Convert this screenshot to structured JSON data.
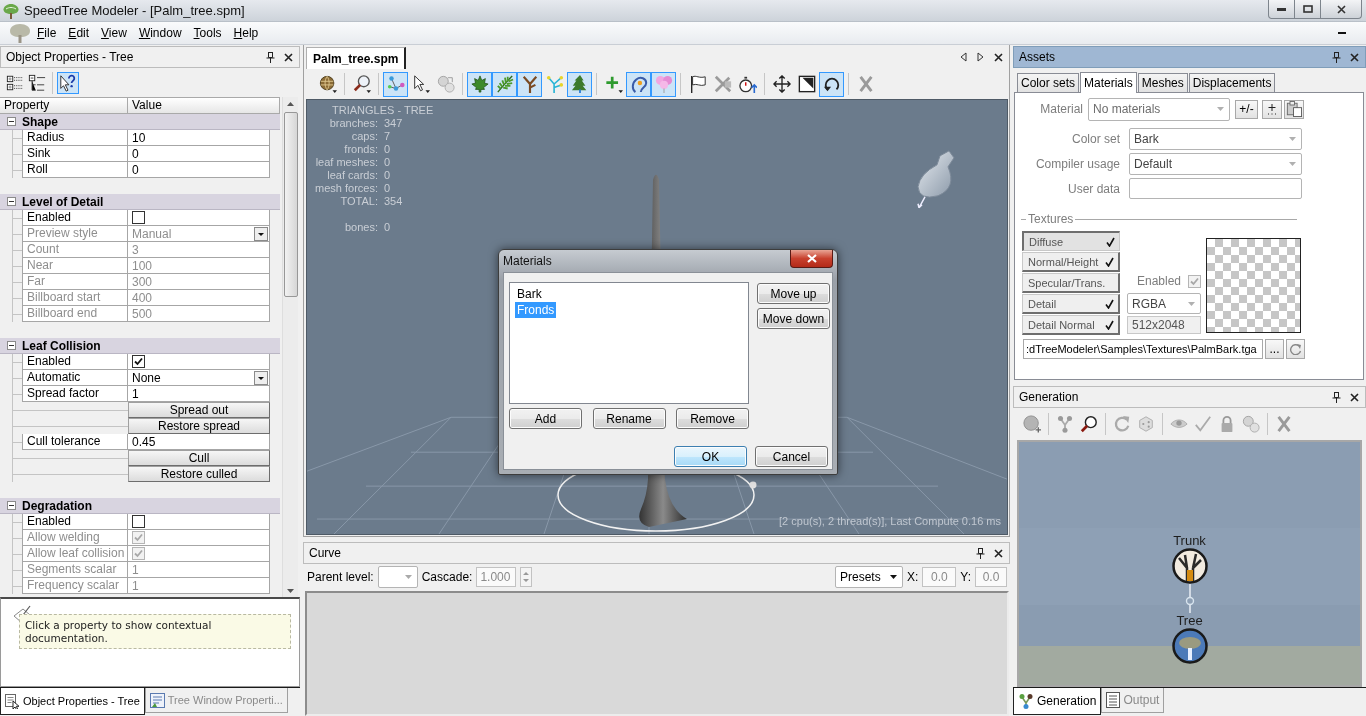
{
  "window": {
    "title": "SpeedTree Modeler - [Palm_tree.spm]"
  },
  "menu": [
    "File",
    "Edit",
    "View",
    "Window",
    "Tools",
    "Help"
  ],
  "object_properties": {
    "title": "Object Properties - Tree",
    "active": false,
    "toolbar": [
      {
        "selected": false
      },
      {
        "selected": false
      },
      {
        "selected": true
      }
    ],
    "columns": [
      "Property",
      "Value"
    ],
    "categories": [
      {
        "name": "Shape",
        "expanded": true,
        "rows": [
          {
            "kind": "text",
            "label": "Radius",
            "value": "10",
            "disabled": false
          },
          {
            "kind": "text",
            "label": "Sink",
            "value": "0",
            "disabled": false
          },
          {
            "kind": "text",
            "label": "Roll",
            "value": "0",
            "disabled": false
          }
        ]
      },
      {
        "name": "Level of Detail",
        "expanded": true,
        "rows": [
          {
            "kind": "checkbox",
            "label": "Enabled",
            "checked": false,
            "disabled": false
          },
          {
            "kind": "dropdown",
            "label": "Preview style",
            "value": "Manual",
            "disabled": true
          },
          {
            "kind": "text",
            "label": "Count",
            "value": "3",
            "disabled": true
          },
          {
            "kind": "text",
            "label": "Near",
            "value": "100",
            "disabled": true
          },
          {
            "kind": "text",
            "label": "Far",
            "value": "300",
            "disabled": true
          },
          {
            "kind": "text",
            "label": "Billboard start",
            "value": "400",
            "disabled": true
          },
          {
            "kind": "text",
            "label": "Billboard end",
            "value": "500",
            "disabled": true
          }
        ]
      },
      {
        "name": "Leaf Collision",
        "expanded": true,
        "rows": [
          {
            "kind": "checkbox",
            "label": "Enabled",
            "checked": true,
            "disabled": false
          },
          {
            "kind": "dropdown",
            "label": "Automatic",
            "value": "None",
            "disabled": false
          },
          {
            "kind": "text",
            "label": "Spread factor",
            "value": "1",
            "disabled": false
          },
          {
            "kind": "button",
            "label": "Spread out",
            "disabled": false
          },
          {
            "kind": "button",
            "label": "Restore spread",
            "disabled": false
          },
          {
            "kind": "text",
            "label": "Cull tolerance",
            "value": "0.45",
            "disabled": false
          },
          {
            "kind": "button",
            "label": "Cull",
            "disabled": false
          },
          {
            "kind": "button",
            "label": "Restore culled",
            "disabled": false
          }
        ]
      },
      {
        "name": "Degradation",
        "expanded": true,
        "rows": [
          {
            "kind": "checkbox",
            "label": "Enabled",
            "checked": false,
            "disabled": false
          },
          {
            "kind": "checkbox",
            "label": "Allow welding",
            "checked": true,
            "disabled": true
          },
          {
            "kind": "checkbox",
            "label": "Allow leaf collision",
            "checked": true,
            "disabled": true
          },
          {
            "kind": "text",
            "label": "Segments scalar",
            "value": "1",
            "disabled": true
          },
          {
            "kind": "text",
            "label": "Frequency scalar",
            "value": "1",
            "disabled": true
          }
        ]
      }
    ],
    "help_text": "Click a property to show contextual documentation.",
    "tabs": [
      {
        "label": "Object Properties - Tree",
        "selected": true
      },
      {
        "label": "Tree Window Properti...",
        "selected": false
      }
    ]
  },
  "document": {
    "tabs": [
      {
        "label": "Palm_tree.spm",
        "selected": true
      }
    ],
    "toolbar": [
      [
        {
          "selected": false
        }
      ],
      [
        {
          "selected": false
        }
      ],
      [
        {
          "selected": true
        },
        {
          "selected": false
        },
        {
          "selected": false
        }
      ],
      [
        {
          "selected": true
        },
        {
          "selected": true
        },
        {
          "selected": true
        },
        {
          "selected": false
        },
        {
          "selected": true
        }
      ],
      [
        {
          "selected": false
        },
        {
          "selected": true
        },
        {
          "selected": true
        }
      ],
      [
        {
          "selected": false
        },
        {
          "selected": false
        },
        {
          "selected": false
        }
      ],
      [
        {
          "selected": false
        },
        {
          "selected": false
        },
        {
          "selected": true
        }
      ],
      [
        {
          "selected": false
        }
      ]
    ],
    "viewport": {
      "stats_title": "TRIANGLES - TREE",
      "stats": [
        [
          {
            "label": "branches:",
            "value": "347"
          },
          {
            "label": "caps:",
            "value": "7"
          },
          {
            "label": "fronds:",
            "value": "0"
          },
          {
            "label": "leaf meshes:",
            "value": "0"
          },
          {
            "label": "leaf cards:",
            "value": "0"
          },
          {
            "label": "mesh forces:",
            "value": "0"
          },
          {
            "label": "TOTAL:",
            "value": "354"
          }
        ],
        [
          {
            "label": "bones:",
            "value": "0"
          }
        ]
      ],
      "status": "[2 cpu(s), 2 thread(s)], Last Compute 0.16 ms"
    }
  },
  "dialog": {
    "title": "Materials",
    "items": [
      {
        "label": "Bark",
        "selected": false
      },
      {
        "label": "Fronds",
        "selected": true
      }
    ],
    "side_buttons": [
      "Move up",
      "Move down"
    ],
    "list_buttons": [
      "Add",
      "Rename",
      "Remove"
    ],
    "buttons": [
      {
        "label": "OK",
        "default": true
      },
      {
        "label": "Cancel",
        "default": false
      }
    ]
  },
  "curve": {
    "title": "Curve",
    "active": false,
    "parent_level": {
      "label": "Parent level:"
    },
    "cascade": {
      "label": "Cascade:",
      "value": "1.000",
      "disabled": true
    },
    "presets": "Presets",
    "x": {
      "label": "X:",
      "value": "0.0",
      "disabled": true
    },
    "y": {
      "label": "Y:",
      "value": "0.0",
      "disabled": true
    }
  },
  "assets": {
    "title": "Assets",
    "active": true,
    "tabs": [
      {
        "label": "Color sets",
        "selected": false
      },
      {
        "label": "Materials",
        "selected": true
      },
      {
        "label": "Meshes",
        "selected": false
      },
      {
        "label": "Displacements",
        "selected": false
      }
    ],
    "material": {
      "label": "Material",
      "value": "No materials"
    },
    "material_buttons": [
      "+/-"
    ],
    "fields": [
      {
        "kind": "dropdown",
        "label": "Color set",
        "value": "Bark"
      },
      {
        "kind": "dropdown",
        "label": "Compiler usage",
        "value": "Default"
      },
      {
        "kind": "input",
        "label": "User data"
      }
    ],
    "textures": {
      "title": "Textures",
      "slots": [
        {
          "label": "Diffuse",
          "checked": true,
          "selected": true
        },
        {
          "label": "Normal/Height",
          "checked": true,
          "selected": false
        },
        {
          "label": "Specular/Trans.",
          "checked": false,
          "selected": false
        },
        {
          "label": "Detail",
          "checked": true,
          "selected": false
        },
        {
          "label": "Detail Normal",
          "checked": true,
          "selected": false
        }
      ],
      "enabled": {
        "label": "Enabled",
        "checked": true
      },
      "format": "RGBA",
      "size": "512x2048",
      "path": ":dTreeModeler\\Samples\\Textures\\PalmBark.tga",
      "browse": "..."
    }
  },
  "generation": {
    "title": "Generation",
    "active": false,
    "nodes": [
      {
        "label": "Tree",
        "children": [
          {
            "label": "Trunk"
          }
        ]
      }
    ],
    "tabs": [
      {
        "label": "Generation",
        "selected": true
      },
      {
        "label": "Output",
        "selected": false
      }
    ]
  }
}
